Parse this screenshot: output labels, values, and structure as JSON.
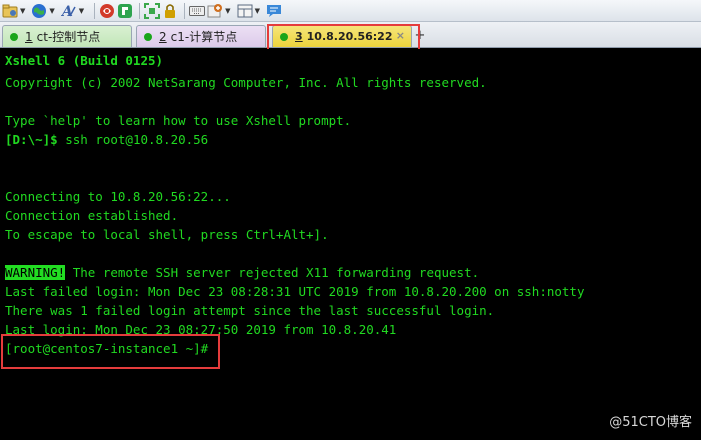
{
  "toolbar": {
    "buttons": [
      {
        "icon": "folder-settings-icon",
        "color": "#4a78b8"
      },
      {
        "icon": "globe-icon",
        "color": "#2a6fd0"
      },
      {
        "icon": "font-icon",
        "color": "#3a5fa8"
      },
      {
        "icon": "xshell-logo-icon",
        "color": "#d23a2a"
      },
      {
        "icon": "xftp-icon",
        "color": "#2ea44f"
      },
      {
        "icon": "fullscreen-icon",
        "color": "#3aa84a"
      },
      {
        "icon": "lock-icon",
        "color": "#d0a000"
      },
      {
        "icon": "keyboard-icon",
        "color": "#666666"
      },
      {
        "icon": "add-session-icon",
        "color": "#d07020"
      },
      {
        "icon": "layout-icon",
        "color": "#5a6a80"
      },
      {
        "icon": "chat-icon",
        "color": "#3a88d8"
      }
    ]
  },
  "tabs": [
    {
      "number": "1",
      "label": "ct-控制节点",
      "status_color": "#1aa51a"
    },
    {
      "number": "2",
      "label": "c1-计算节点",
      "status_color": "#1aa51a"
    },
    {
      "number": "3",
      "label": "10.8.20.56:22",
      "status_color": "#1aa51a",
      "close": "×"
    }
  ],
  "add_tab": "+",
  "terminal": {
    "header_line": "Xshell 6 (Build 0125)",
    "copyright": "Copyright (c) 2002 NetSarang Computer, Inc. All rights reserved.",
    "help_text": "Type `help' to learn how to use Xshell prompt.",
    "local_prompt": "[D:\\~]$",
    "ssh_command": " ssh root@10.8.20.56",
    "connecting": "Connecting to 10.8.20.56:22...",
    "established": "Connection established.",
    "escape_hint": "To escape to local shell, press Ctrl+Alt+].",
    "warning_label": "WARNING!",
    "warning_text": " The remote SSH server rejected X11 forwarding request.",
    "last_failed": "Last failed login: Mon Dec 23 08:28:31 UTC 2019 from 10.8.20.200 on ssh:notty",
    "failed_count": "There was 1 failed login attempt since the last successful login.",
    "last_login": "Last login: Mon Dec 23 08:27:50 2019 from 10.8.20.41",
    "remote_prompt": "[root@centos7-instance1 ~]#",
    "text_color": "#21d921",
    "background": "#000000"
  },
  "watermark": "@51CTO博客",
  "highlight_color": "#e53c3c"
}
